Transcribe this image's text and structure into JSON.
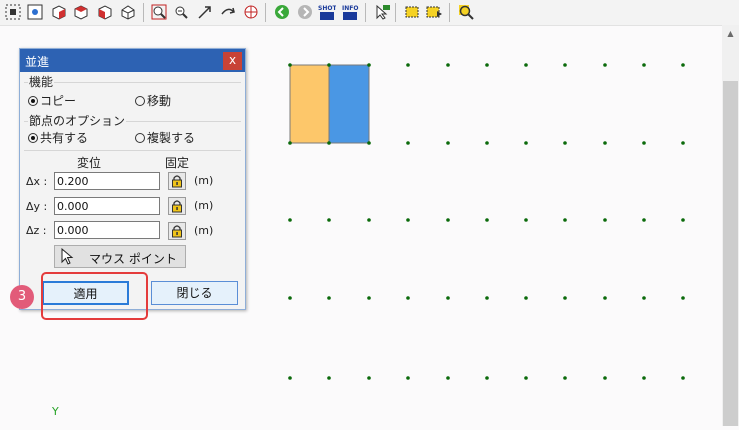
{
  "dialog": {
    "title": "並進",
    "close_glyph": "x",
    "function_section": {
      "label": "機能",
      "options": [
        {
          "label": "コピー",
          "selected": true
        },
        {
          "label": "移動",
          "selected": false
        }
      ]
    },
    "node_section": {
      "label": "節点のオプション",
      "options": [
        {
          "label": "共有する",
          "selected": true
        },
        {
          "label": "複製する",
          "selected": false
        }
      ]
    },
    "columns": {
      "displacement": "変位",
      "fixed": "固定"
    },
    "rows": [
      {
        "label": "Δx :",
        "value": "0.200",
        "unit": "(m)"
      },
      {
        "label": "Δy :",
        "value": "0.000",
        "unit": "(m)"
      },
      {
        "label": "Δz :",
        "value": "0.000",
        "unit": "(m)"
      }
    ],
    "mouse_point_label": "マウス ポイント",
    "apply_label": "適用",
    "close_label": "閉じる"
  },
  "annotation": {
    "step_number": "3",
    "badge_color": "#e25b79",
    "highlight_color": "#e43b3b"
  },
  "canvas": {
    "axis_label": "Y",
    "panel_colors": [
      "#fdc76a",
      "#4a97e4"
    ]
  },
  "toolbar_icons": [
    "select-all-icon",
    "select-node-icon",
    "cube-red-icon",
    "cube-red-2-icon",
    "cube-red-3-icon",
    "cube-outline-icon",
    "zoom-window-icon",
    "zoom-out-icon",
    "arrow-icon",
    "rotate-icon",
    "globe-icon",
    "back-icon",
    "forward-icon",
    "shot-icon",
    "info-icon",
    "cursor-icon",
    "yellow-box-icon",
    "yellow-box-2-icon",
    "magnifier-icon"
  ],
  "toolbar_text": {
    "shot": "SHOT",
    "info": "INFO"
  },
  "colors": {
    "accent": "#2d62b3",
    "grid_dot": "#0b6a0b"
  }
}
